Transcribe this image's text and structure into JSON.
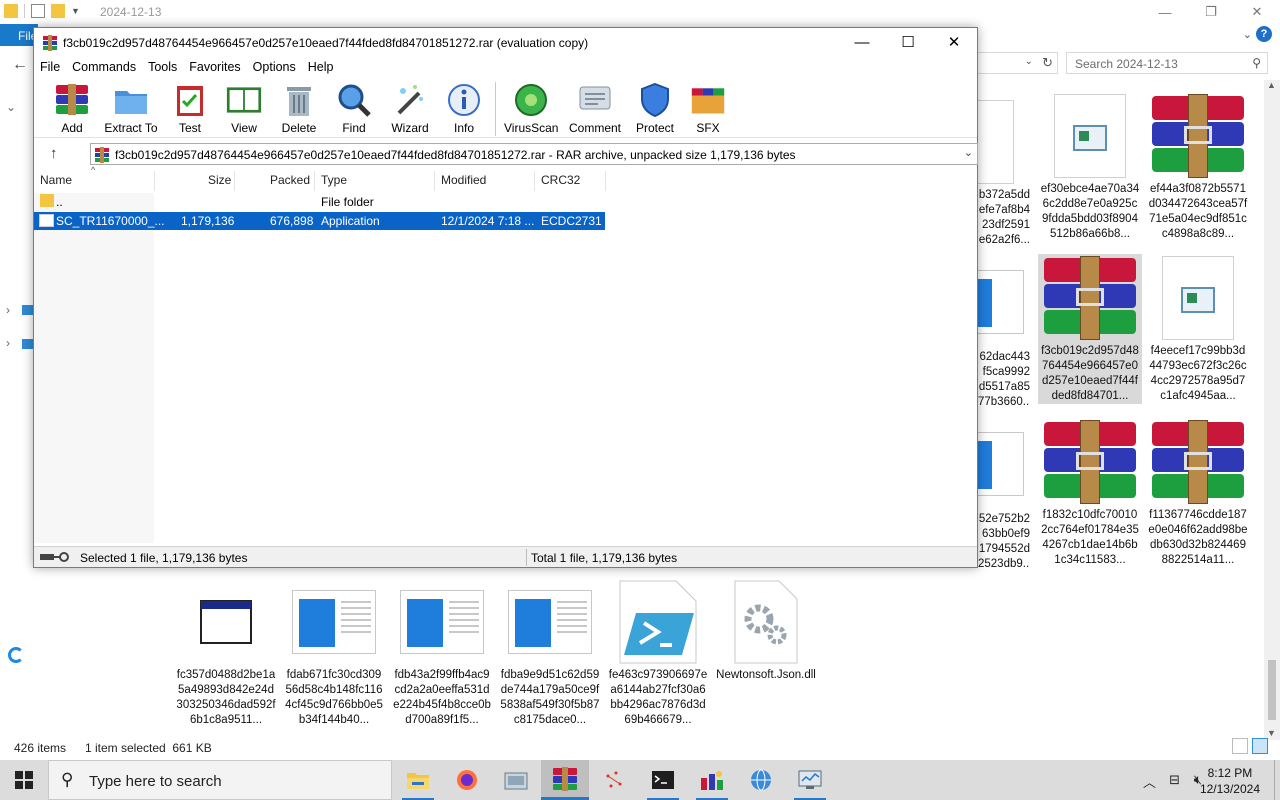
{
  "explorer": {
    "title": "2024-12-13",
    "file_tab": "File",
    "search_placeholder": "Search 2024-12-13",
    "status_items": "426 items",
    "status_selected": "1 item selected  661 KB",
    "tiles": [
      {
        "name": "ef30ebce4ae70a346c2dd8e7e0a925c9fdda5bdd03f8904512b86a66b8...",
        "kind": "paper"
      },
      {
        "name": "ef44a3f0872b5571d034472643cea57f71e5a04ec9df851cc4898a8c89...",
        "kind": "rar"
      },
      {
        "name": "f3cb019c2d957d48764454e966457e0d257e10eaed7f44fded8fd84701...",
        "kind": "rar",
        "selected": true
      },
      {
        "name": "f4eecef17c99bb3d44793ec672f3c26c4cc2972578a95d7c1afc4945aa...",
        "kind": "paper"
      },
      {
        "name": "f1832c10dfc700102cc764ef01784e354267cb1dae14b6b1c34c11583...",
        "kind": "rar"
      },
      {
        "name": "f11367746cdde187e0e046f62add98bedb630d32b8244698822514a11...",
        "kind": "rar"
      },
      {
        "name": "fc357d0488d2be1a5a49893d842e24d303250346dad592f6b1c8a9511...",
        "kind": "exe"
      },
      {
        "name": "fdab671fc30cd30956d58c4b148fc1164cf45c9d766bb0e5b34f144b40...",
        "kind": "doc"
      },
      {
        "name": "fdb43a2f99ffb4ac9cd2a2a0eeffa531de224b45f4b8cce0bd700a89f1f5...",
        "kind": "doc"
      },
      {
        "name": "fdba9e9d51c62d59de744a179a50ce9f5838af549f30f5b87c8175dace0...",
        "kind": "doc"
      },
      {
        "name": "fe463c973906697ea6144ab27fcf30a6bb4296ac7876d3d69b466679...",
        "kind": "ps"
      },
      {
        "name": "Newtonsoft.Json.dll",
        "kind": "dll"
      }
    ],
    "partials": [
      {
        "text": "b372a5dd\nefe7af8b4\n23df2591\ne62a2f6..."
      },
      {
        "text": "62dac443\nf5ca9992\nd5517a85\n77b3660..."
      },
      {
        "text": "52e752b2\n63bb0ef9\n1794552d\n2523db9..."
      }
    ]
  },
  "winrar": {
    "title": "f3cb019c2d957d48764454e966457e0d257e10eaed7f44fded8fd84701851272.rar (evaluation copy)",
    "menu": [
      "File",
      "Commands",
      "Tools",
      "Favorites",
      "Options",
      "Help"
    ],
    "toolbar": [
      "Add",
      "Extract To",
      "Test",
      "View",
      "Delete",
      "Find",
      "Wizard",
      "Info",
      "VirusScan",
      "Comment",
      "Protect",
      "SFX"
    ],
    "path": "f3cb019c2d957d48764454e966457e0d257e10eaed7f44fded8fd84701851272.rar - RAR archive, unpacked size 1,179,136 bytes",
    "columns": [
      "Name",
      "Size",
      "Packed",
      "Type",
      "Modified",
      "CRC32"
    ],
    "rows": [
      {
        "name": "..",
        "size": "",
        "packed": "",
        "type": "File folder",
        "modified": "",
        "crc": ""
      },
      {
        "name": "SC_TR11670000_...",
        "size": "1,179,136",
        "packed": "676,898",
        "type": "Application",
        "modified": "12/1/2024 7:18 ...",
        "crc": "ECDC2731"
      }
    ],
    "status_left": "Selected 1 file, 1,179,136 bytes",
    "status_right": "Total 1 file, 1,179,136 bytes"
  },
  "taskbar": {
    "search_placeholder": "Type here to search",
    "time": "8:12 PM",
    "date": "12/13/2024"
  }
}
